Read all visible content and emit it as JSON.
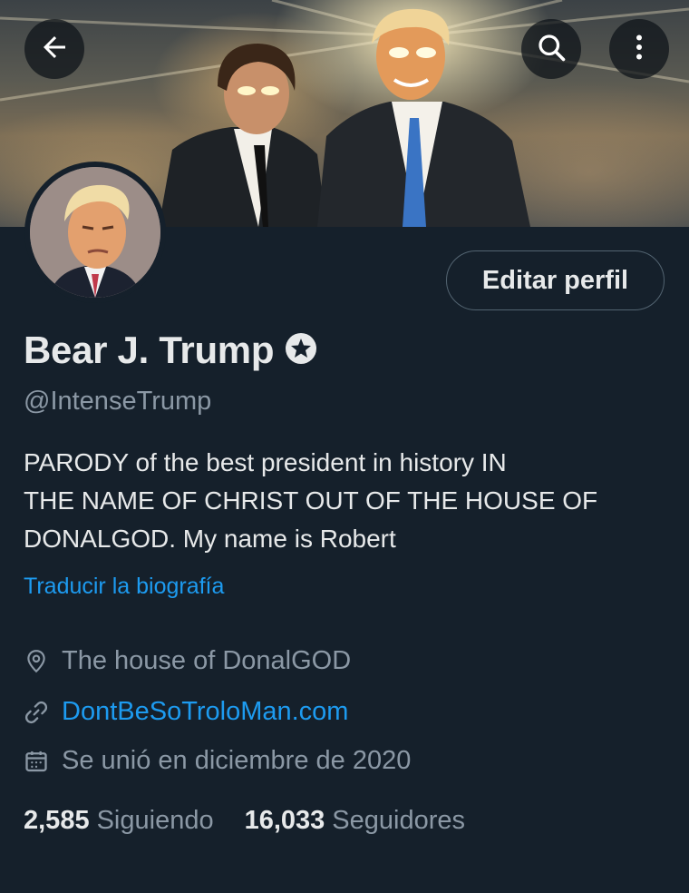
{
  "header": {
    "back_icon": "arrow-left-icon",
    "search_icon": "search-icon",
    "more_icon": "more-vertical-icon",
    "banner_alt": "Illustrated banner of two men in suits with glowing eyes against a golden sky"
  },
  "profile": {
    "edit_button_label": "Editar perfil",
    "display_name": "Bear J. Trump",
    "verified_icon": "verified-badge-icon",
    "handle": "@IntenseTrump",
    "bio": "PARODY of the best president in history  IN\nTHE NAME OF CHRIST OUT OF THE HOUSE OF\nDONALGOD. My name is Robert",
    "translate_label": "Traducir la biografía",
    "location": "The house of DonalGOD",
    "website": "DontBeSoTroloMan.com",
    "joined": "Se unió en diciembre de 2020"
  },
  "stats": {
    "following_count": "2,585",
    "following_label": "Siguiendo",
    "followers_count": "16,033",
    "followers_label": "Seguidores"
  },
  "colors": {
    "background": "#15202b",
    "accent": "#1d9bf0",
    "secondary_text": "#8b98a5"
  }
}
